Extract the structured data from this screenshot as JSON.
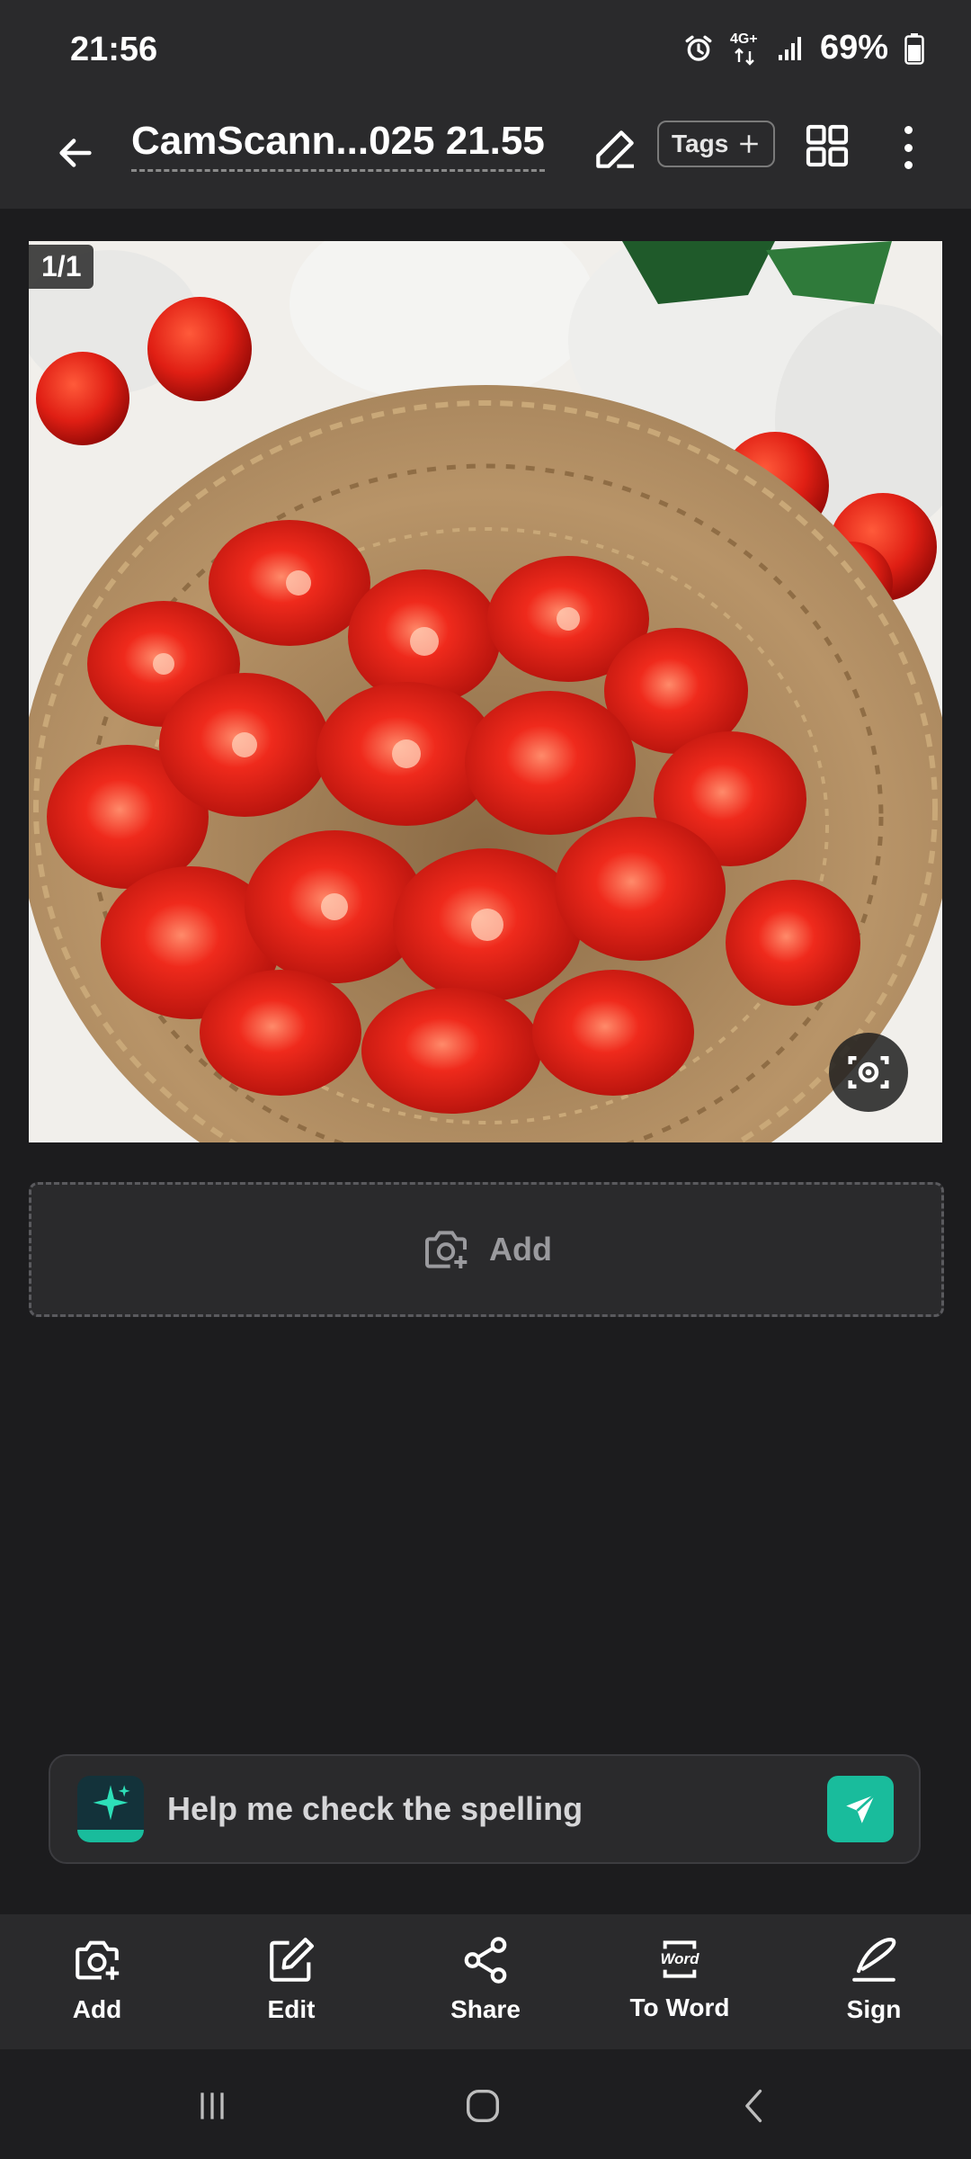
{
  "status_bar": {
    "time": "21:56",
    "network": "4G+",
    "battery": "69%",
    "icons": [
      "alarm-icon",
      "network-4g-icon",
      "signal-icon",
      "battery-icon"
    ]
  },
  "app_bar": {
    "title": "CamScann...025 21.55",
    "tags_label": "Tags",
    "icons": [
      "back-arrow-icon",
      "pencil-icon",
      "plus-icon",
      "grid-view-icon",
      "more-vertical-icon"
    ]
  },
  "page_view": {
    "page_counter": "1/1",
    "image_description_icon": "rescan-camera-icon"
  },
  "add_slot": {
    "label": "Add",
    "icon": "add-photo-icon"
  },
  "ai_prompt": {
    "text": "Help me check the spelling",
    "icons": [
      "ai-sparkle-icon",
      "send-icon"
    ],
    "accent": "#19bc9c"
  },
  "toolbar": {
    "items": [
      {
        "label": "Add",
        "icon": "add-photo-icon"
      },
      {
        "label": "Edit",
        "icon": "edit-icon"
      },
      {
        "label": "Share",
        "icon": "share-icon"
      },
      {
        "label": "To Word",
        "icon": "word-icon"
      },
      {
        "label": "Sign",
        "icon": "signature-icon"
      }
    ],
    "word_glyph": "Word"
  },
  "nav_bar": {
    "icons": [
      "recents-icon",
      "home-icon",
      "back-icon"
    ]
  }
}
